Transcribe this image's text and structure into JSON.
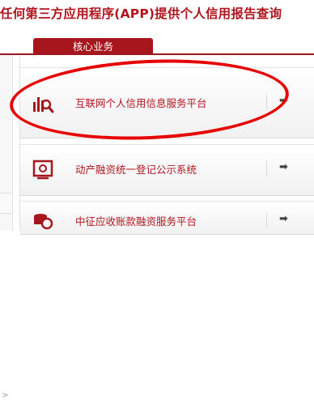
{
  "notice": "任何第三方应用程序(APP)提供个人信用报告查询",
  "tab": {
    "label": "核心业务"
  },
  "services": [
    {
      "label": "互联网个人信用信息服务平台",
      "icon": "magnifier-chart-icon"
    },
    {
      "label": "动产融资统一登记公示系统",
      "icon": "contract-seal-icon"
    },
    {
      "label": "中征应收账款融资服务平台",
      "icon": "coin-stack-icon"
    }
  ],
  "colors": {
    "brand_red": "#a8161d",
    "text_red": "#b0141c",
    "annotation_red": "#e60000"
  }
}
